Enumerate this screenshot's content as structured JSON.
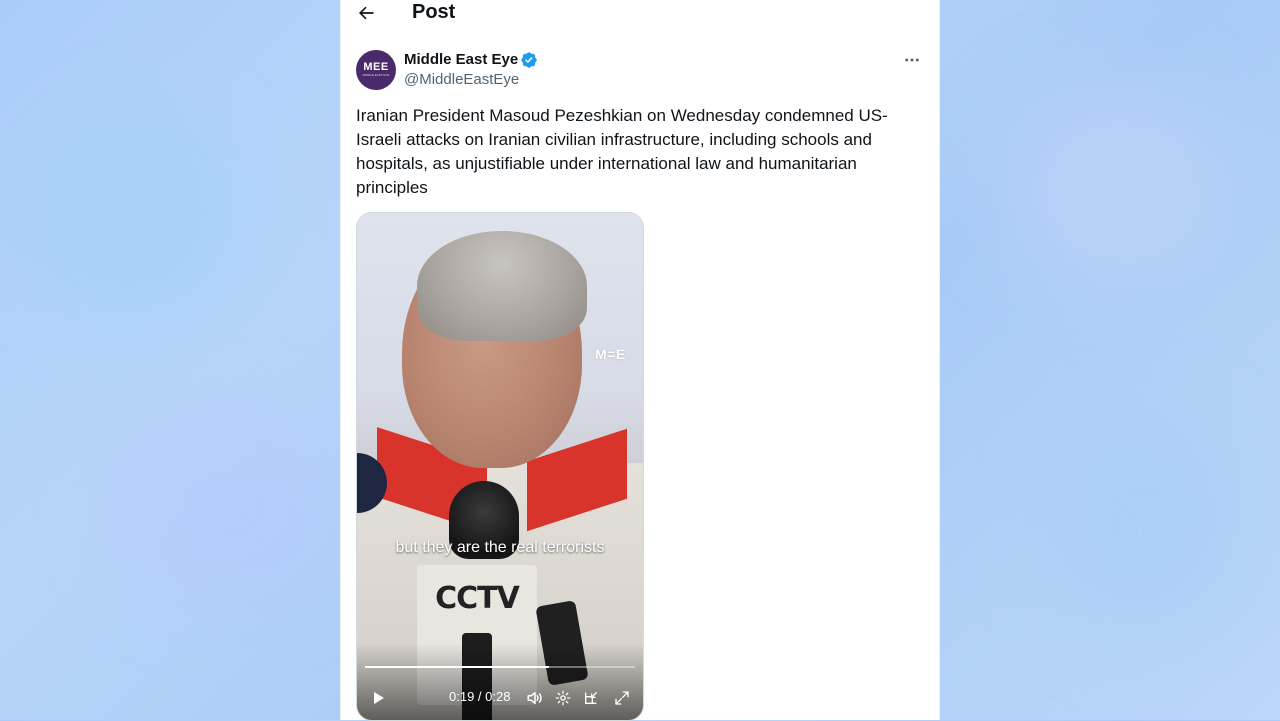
{
  "header": {
    "title": "Post"
  },
  "author": {
    "avatar_text": "MEE",
    "avatar_subtext": "MIDDLE EAST EYE",
    "display_name": "Middle East Eye",
    "handle": "@MiddleEastEye",
    "verified": true
  },
  "tweet": {
    "text": "Iranian President Masoud Pezeshkian on Wednesday condemned US-Israeli attacks on Iranian civilian infrastructure, including schools and hospitals, as unjustifiable under international law and humanitarian principles"
  },
  "video": {
    "watermark": "M=E",
    "caption": "but they are the real terrorists",
    "logo_text": "CCTV",
    "current_time": "0:19",
    "duration": "0:28",
    "time_display": "0:19 / 0:28",
    "progress_fraction": 0.68
  },
  "icons": {
    "back": "back-arrow-icon",
    "verified": "verified-badge-icon",
    "more": "more-icon",
    "play": "play-icon",
    "volume": "volume-icon",
    "settings": "settings-icon",
    "minimize": "pip-icon",
    "fullscreen": "fullscreen-icon"
  },
  "colors": {
    "verified_blue": "#1d9bf0",
    "text_primary": "#0f1419",
    "text_secondary": "#536471"
  }
}
